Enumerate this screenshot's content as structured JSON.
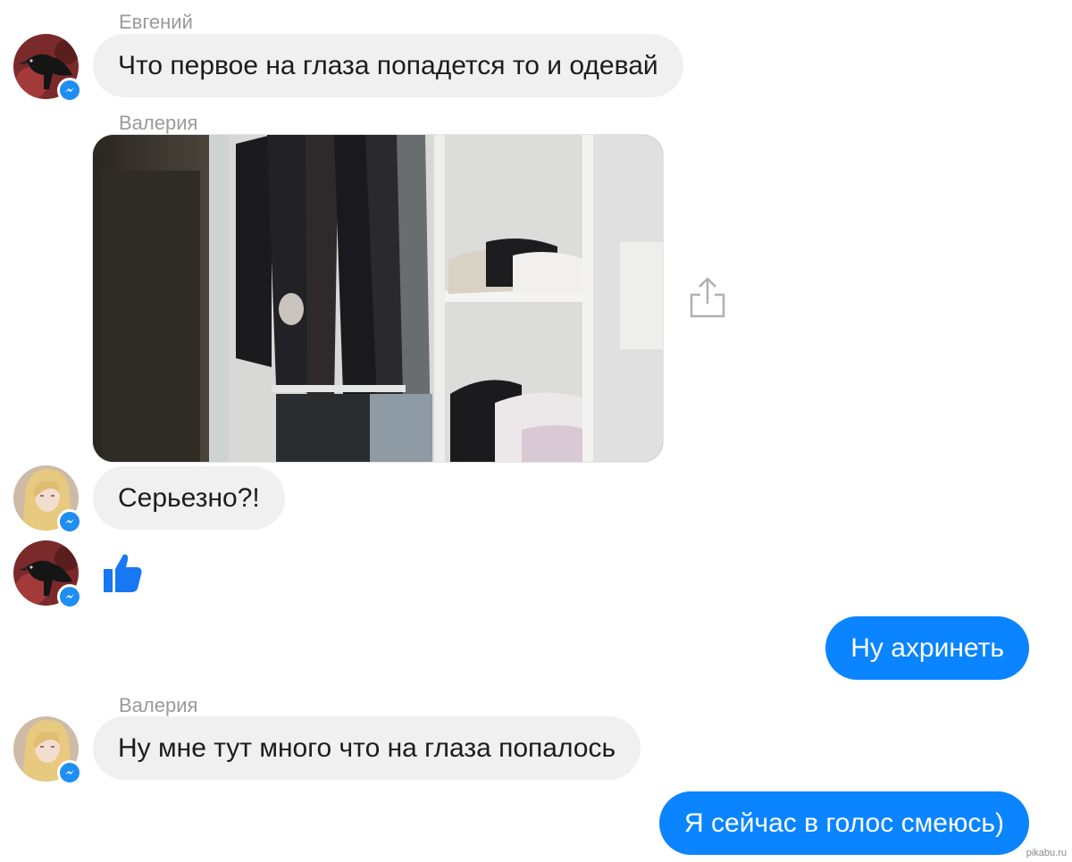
{
  "messages": {
    "m1": {
      "sender": "Евгений",
      "text": "Что первое на глаза попадется то и одевай"
    },
    "m2": {
      "sender": "Валерия",
      "attachment": "photo"
    },
    "m3": {
      "text": "Серьезно?!"
    },
    "m4": {
      "reaction": "thumbs-up-icon"
    },
    "m5": {
      "text": "Ну ахринеть"
    },
    "m6": {
      "sender": "Валерия",
      "text": "Ну мне тут много что на глаза попалось"
    },
    "m7": {
      "text": "Я сейчас в голос смеюсь)"
    }
  },
  "watermark": "pikabu.ru",
  "colors": {
    "outgoing_bubble": "#0a84ff",
    "incoming_bubble": "#f0f0f0",
    "sender_name": "#9a9a9a",
    "badge": "#1f8ef1",
    "like": "#1877f2"
  }
}
